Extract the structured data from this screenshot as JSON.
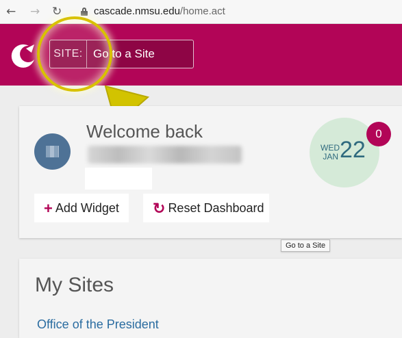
{
  "browser": {
    "back_icon": "←",
    "forward_icon": "→",
    "reload_icon": "↻",
    "url_host": "cascade.nmsu.edu",
    "url_path": "/home.act"
  },
  "header": {
    "brand_color": "#b20557",
    "site_label": "SITE:",
    "site_value": "Go to a Site"
  },
  "welcome": {
    "title": "Welcome back",
    "add_widget_icon": "+",
    "add_widget_label": "Add Widget",
    "reset_icon": "↻",
    "reset_label": "Reset Dashboard",
    "date_weekday": "WED",
    "date_month": "JAN",
    "date_day": "22",
    "notification_count": "0"
  },
  "tooltip": {
    "text": "Go to a Site"
  },
  "my_sites": {
    "title": "My Sites",
    "items": [
      {
        "label": "Office of the President"
      }
    ]
  },
  "annotation": {
    "highlight_color": "#d8c200"
  }
}
